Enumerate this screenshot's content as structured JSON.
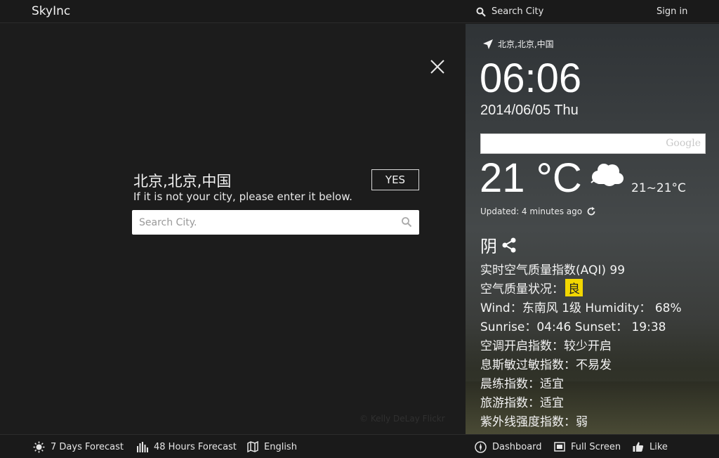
{
  "topbar": {
    "brand": "SkyInc",
    "search_label": "Search City",
    "signin_label": "Sign in"
  },
  "city_prompt": {
    "detected_city": "北京,北京,中国",
    "instruction": "If it is not your city, please enter it below.",
    "yes_label": "YES",
    "search_placeholder": "Search City.",
    "photo_credit": "© Kelly DeLay Flickr"
  },
  "weather": {
    "location": "北京,北京,中国",
    "time": "06:06",
    "date": "2014/06/05 Thu",
    "google_label": "Google",
    "temperature": "21 °C",
    "range": "21~21°C",
    "updated": "Updated: 4 minutes ago",
    "condition": "阴",
    "aqi": "实时空气质量指数(AQI) 99",
    "aqi_status_label": "空气质量状况：",
    "aqi_status": "良",
    "aqi_status_color": "#f2d600",
    "wind_humidity": "Wind：东南风 1级  Humidity： 68%",
    "sun": "Sunrise：04:46  Sunset： 19:38",
    "ac_index": "空调开启指数：较少开启",
    "allergy_index": "息斯敏过敏指数：不易发",
    "exercise_index": "晨练指数：适宜",
    "travel_index": "旅游指数：适宜",
    "uv_index": "紫外线强度指数：弱"
  },
  "bottombar": {
    "forecast7": "7 Days Forecast",
    "forecast48": "48 Hours Forecast",
    "language": "English",
    "dashboard": "Dashboard",
    "fullscreen": "Full Screen",
    "like": "Like"
  },
  "icons": {
    "top_search": "search-icon",
    "close": "close-icon",
    "location": "location-arrow-icon",
    "weather": "cloudy-icon",
    "refresh": "refresh-icon",
    "share": "share-icon",
    "sun": "sun-icon",
    "bars": "bar-chart-icon",
    "language": "map-icon",
    "dashboard": "compass-icon",
    "fullscreen": "fullscreen-icon",
    "like": "thumbs-up-icon"
  }
}
